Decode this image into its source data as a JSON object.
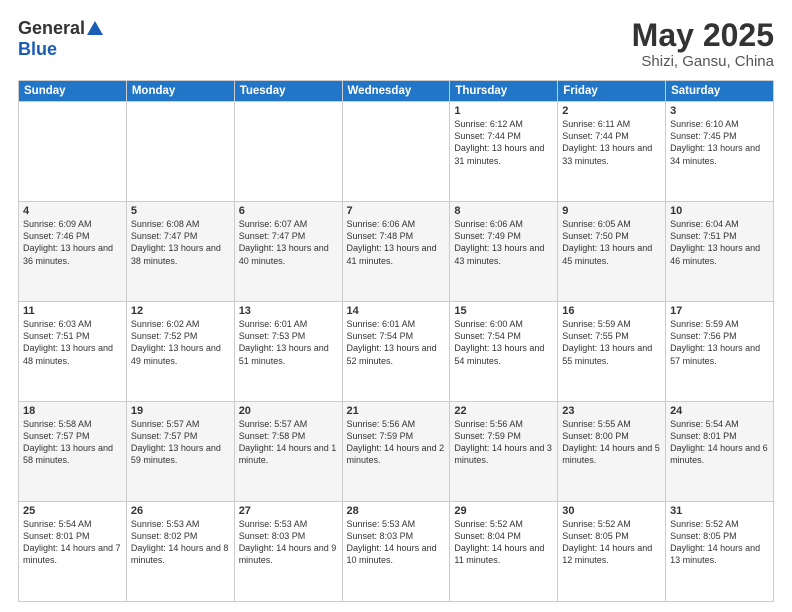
{
  "header": {
    "logo_general": "General",
    "logo_blue": "Blue",
    "title": "May 2025",
    "subtitle": "Shizi, Gansu, China"
  },
  "days_of_week": [
    "Sunday",
    "Monday",
    "Tuesday",
    "Wednesday",
    "Thursday",
    "Friday",
    "Saturday"
  ],
  "weeks": [
    [
      {
        "day": "",
        "info": ""
      },
      {
        "day": "",
        "info": ""
      },
      {
        "day": "",
        "info": ""
      },
      {
        "day": "",
        "info": ""
      },
      {
        "day": "1",
        "info": "Sunrise: 6:12 AM\nSunset: 7:44 PM\nDaylight: 13 hours and 31 minutes."
      },
      {
        "day": "2",
        "info": "Sunrise: 6:11 AM\nSunset: 7:44 PM\nDaylight: 13 hours and 33 minutes."
      },
      {
        "day": "3",
        "info": "Sunrise: 6:10 AM\nSunset: 7:45 PM\nDaylight: 13 hours and 34 minutes."
      }
    ],
    [
      {
        "day": "4",
        "info": "Sunrise: 6:09 AM\nSunset: 7:46 PM\nDaylight: 13 hours and 36 minutes."
      },
      {
        "day": "5",
        "info": "Sunrise: 6:08 AM\nSunset: 7:47 PM\nDaylight: 13 hours and 38 minutes."
      },
      {
        "day": "6",
        "info": "Sunrise: 6:07 AM\nSunset: 7:47 PM\nDaylight: 13 hours and 40 minutes."
      },
      {
        "day": "7",
        "info": "Sunrise: 6:06 AM\nSunset: 7:48 PM\nDaylight: 13 hours and 41 minutes."
      },
      {
        "day": "8",
        "info": "Sunrise: 6:06 AM\nSunset: 7:49 PM\nDaylight: 13 hours and 43 minutes."
      },
      {
        "day": "9",
        "info": "Sunrise: 6:05 AM\nSunset: 7:50 PM\nDaylight: 13 hours and 45 minutes."
      },
      {
        "day": "10",
        "info": "Sunrise: 6:04 AM\nSunset: 7:51 PM\nDaylight: 13 hours and 46 minutes."
      }
    ],
    [
      {
        "day": "11",
        "info": "Sunrise: 6:03 AM\nSunset: 7:51 PM\nDaylight: 13 hours and 48 minutes."
      },
      {
        "day": "12",
        "info": "Sunrise: 6:02 AM\nSunset: 7:52 PM\nDaylight: 13 hours and 49 minutes."
      },
      {
        "day": "13",
        "info": "Sunrise: 6:01 AM\nSunset: 7:53 PM\nDaylight: 13 hours and 51 minutes."
      },
      {
        "day": "14",
        "info": "Sunrise: 6:01 AM\nSunset: 7:54 PM\nDaylight: 13 hours and 52 minutes."
      },
      {
        "day": "15",
        "info": "Sunrise: 6:00 AM\nSunset: 7:54 PM\nDaylight: 13 hours and 54 minutes."
      },
      {
        "day": "16",
        "info": "Sunrise: 5:59 AM\nSunset: 7:55 PM\nDaylight: 13 hours and 55 minutes."
      },
      {
        "day": "17",
        "info": "Sunrise: 5:59 AM\nSunset: 7:56 PM\nDaylight: 13 hours and 57 minutes."
      }
    ],
    [
      {
        "day": "18",
        "info": "Sunrise: 5:58 AM\nSunset: 7:57 PM\nDaylight: 13 hours and 58 minutes."
      },
      {
        "day": "19",
        "info": "Sunrise: 5:57 AM\nSunset: 7:57 PM\nDaylight: 13 hours and 59 minutes."
      },
      {
        "day": "20",
        "info": "Sunrise: 5:57 AM\nSunset: 7:58 PM\nDaylight: 14 hours and 1 minute."
      },
      {
        "day": "21",
        "info": "Sunrise: 5:56 AM\nSunset: 7:59 PM\nDaylight: 14 hours and 2 minutes."
      },
      {
        "day": "22",
        "info": "Sunrise: 5:56 AM\nSunset: 7:59 PM\nDaylight: 14 hours and 3 minutes."
      },
      {
        "day": "23",
        "info": "Sunrise: 5:55 AM\nSunset: 8:00 PM\nDaylight: 14 hours and 5 minutes."
      },
      {
        "day": "24",
        "info": "Sunrise: 5:54 AM\nSunset: 8:01 PM\nDaylight: 14 hours and 6 minutes."
      }
    ],
    [
      {
        "day": "25",
        "info": "Sunrise: 5:54 AM\nSunset: 8:01 PM\nDaylight: 14 hours and 7 minutes."
      },
      {
        "day": "26",
        "info": "Sunrise: 5:53 AM\nSunset: 8:02 PM\nDaylight: 14 hours and 8 minutes."
      },
      {
        "day": "27",
        "info": "Sunrise: 5:53 AM\nSunset: 8:03 PM\nDaylight: 14 hours and 9 minutes."
      },
      {
        "day": "28",
        "info": "Sunrise: 5:53 AM\nSunset: 8:03 PM\nDaylight: 14 hours and 10 minutes."
      },
      {
        "day": "29",
        "info": "Sunrise: 5:52 AM\nSunset: 8:04 PM\nDaylight: 14 hours and 11 minutes."
      },
      {
        "day": "30",
        "info": "Sunrise: 5:52 AM\nSunset: 8:05 PM\nDaylight: 14 hours and 12 minutes."
      },
      {
        "day": "31",
        "info": "Sunrise: 5:52 AM\nSunset: 8:05 PM\nDaylight: 14 hours and 13 minutes."
      }
    ]
  ]
}
